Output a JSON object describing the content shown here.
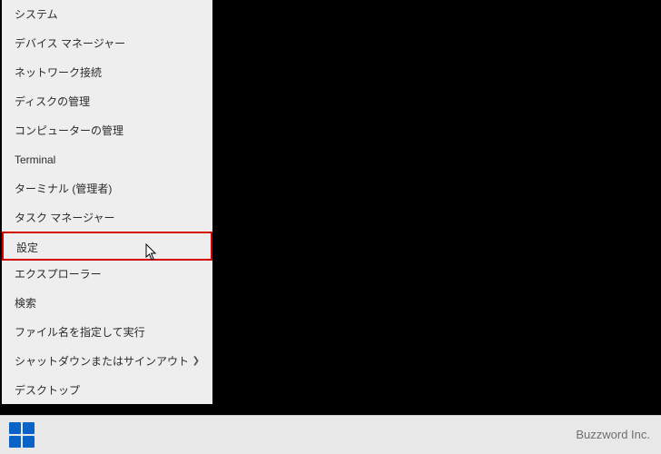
{
  "menu": {
    "items": [
      {
        "label": "システム"
      },
      {
        "label": "デバイス マネージャー"
      },
      {
        "label": "ネットワーク接続"
      },
      {
        "label": "ディスクの管理"
      },
      {
        "label": "コンピューターの管理"
      },
      {
        "label": "Terminal"
      },
      {
        "label": "ターミナル (管理者)"
      },
      {
        "label": "タスク マネージャー"
      },
      {
        "label": "設定",
        "highlighted": true
      },
      {
        "label": "エクスプローラー"
      },
      {
        "label": "検索"
      },
      {
        "label": "ファイル名を指定して実行"
      },
      {
        "label": "シャットダウンまたはサインアウト",
        "submenu": true
      },
      {
        "label": "デスクトップ"
      }
    ]
  },
  "taskbar": {
    "start_name": "start-button"
  },
  "brand": "Buzzword Inc."
}
